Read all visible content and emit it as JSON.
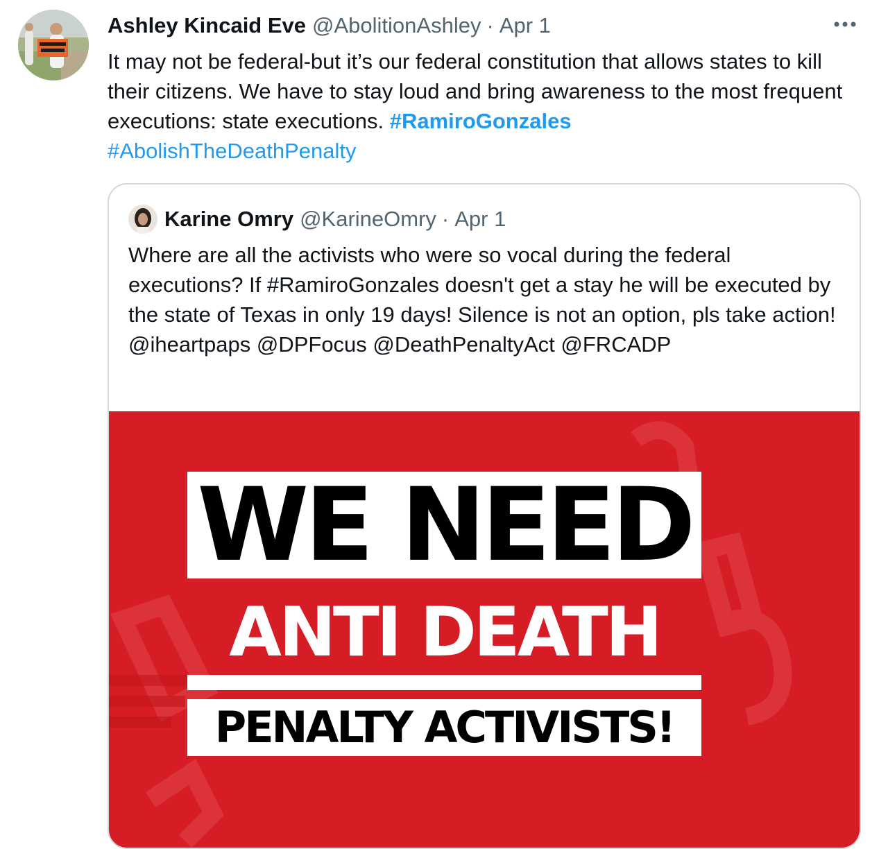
{
  "tweet": {
    "display_name": "Ashley Kincaid Eve",
    "handle": "@AbolitionAshley",
    "separator": "·",
    "date": "Apr 1",
    "more_icon": "more-horizontal-icon",
    "avatar_sign_text": "THOU SHALT NOT KILL!",
    "text_body": "It may not be federal-but it’s our federal constitution that allows states to kill their citizens. We have to stay loud and bring awareness to the most frequent executions: state executions.",
    "hashtag_1": "#RamiroGonzales",
    "hashtag_2": "#AbolishTheDeathPenalty",
    "link_color": "#1d9bf0"
  },
  "quote": {
    "display_name": "Karine Omry",
    "handle": "@KarineOmry",
    "separator": "·",
    "date": "Apr 1",
    "text": "Where are all the activists who were so vocal during the federal executions? If #RamiroGonzales doesn't get a stay he will be executed by the state of Texas in only 19 days! Silence is not an option, pls take action!",
    "mentions": "@iheartpaps @DPFocus @DeathPenaltyAct @FRCADP",
    "image": {
      "line_1": "WE NEED",
      "line_2": "ANTI DEATH",
      "line_3": "PENALTY ACTIVISTS!",
      "background_color": "#d61c24"
    }
  }
}
